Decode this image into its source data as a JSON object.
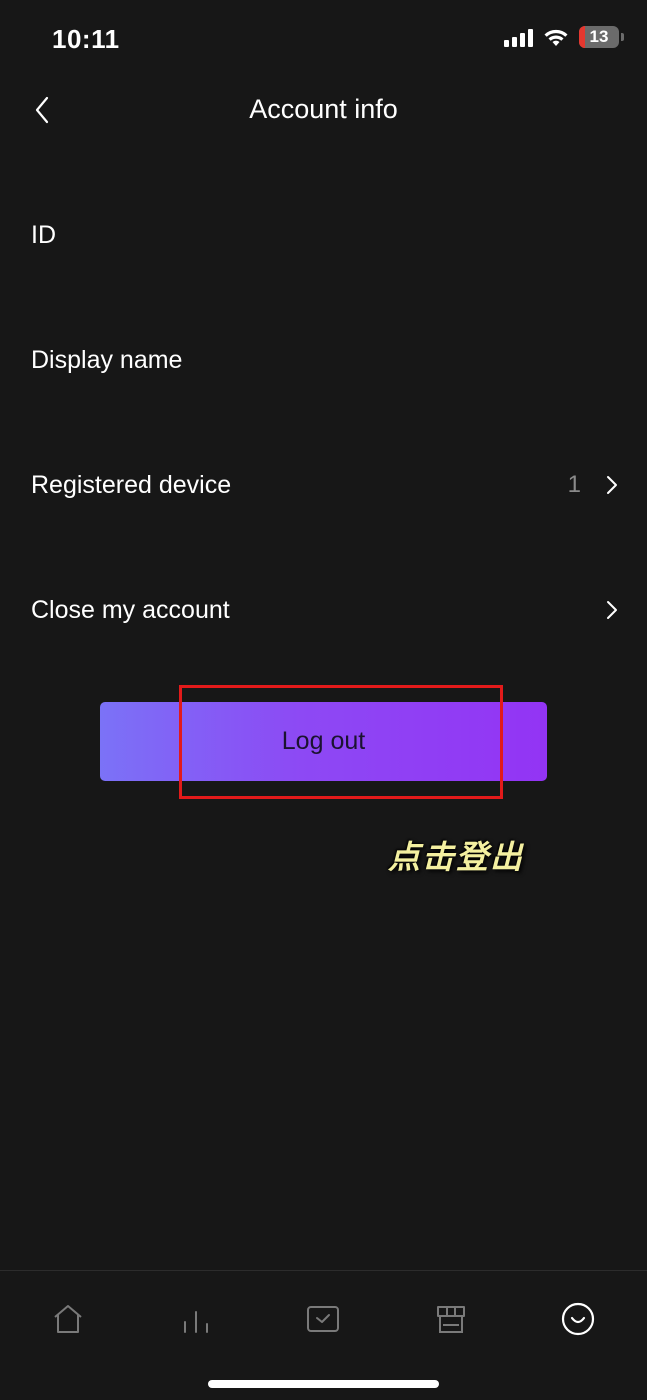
{
  "status_bar": {
    "time": "10:11",
    "battery": "13"
  },
  "nav": {
    "title": "Account info",
    "back_icon": "chevron-left-icon"
  },
  "rows": [
    {
      "label": "ID",
      "value": "",
      "has_chevron": false
    },
    {
      "label": "Display name",
      "value": "",
      "has_chevron": false
    },
    {
      "label": "Registered device",
      "value": "1",
      "has_chevron": true
    },
    {
      "label": "Close my account",
      "value": "",
      "has_chevron": true
    }
  ],
  "logout": {
    "label": "Log out",
    "gradient_start": "#7b72f7",
    "gradient_end": "#9334f4"
  },
  "annotation": {
    "text": "点击登出",
    "highlight_color": "#e21a1a",
    "text_color": "#f4f0a0"
  },
  "tab_bar": {
    "items": [
      {
        "icon": "home-icon",
        "active": false
      },
      {
        "icon": "stats-icon",
        "active": false
      },
      {
        "icon": "task-icon",
        "active": false
      },
      {
        "icon": "store-icon",
        "active": false
      },
      {
        "icon": "profile-icon",
        "active": true
      }
    ]
  },
  "colors": {
    "background": "#171717",
    "text": "#ffffff",
    "muted": "#8a8a8a"
  }
}
